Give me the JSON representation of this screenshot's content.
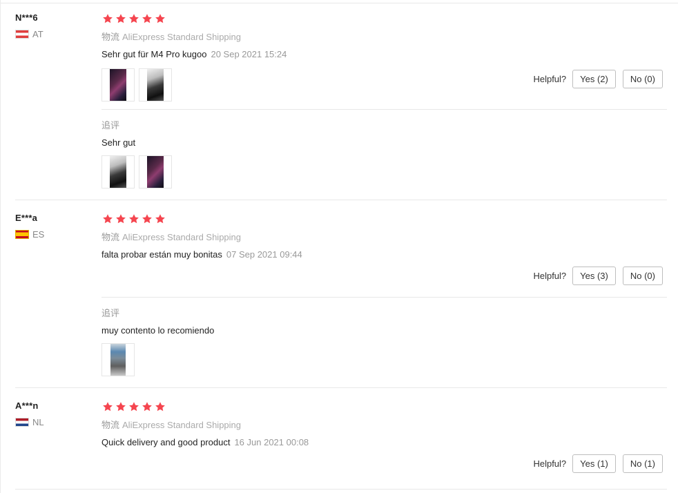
{
  "helpful_label": "Helpful?",
  "additional_label": "追评",
  "shipping_label": "物流",
  "reviews": [
    {
      "user": "N***6",
      "country": "AT",
      "rating": 5,
      "shipping_method": "AliExpress Standard Shipping",
      "text": "Sehr gut für M4 Pro kugoo",
      "date": "20 Sep 2021 15:24",
      "yes_label": "Yes (2)",
      "no_label": "No (0)",
      "additional_text": "Sehr gut"
    },
    {
      "user": "E***a",
      "country": "ES",
      "rating": 5,
      "shipping_method": "AliExpress Standard Shipping",
      "text": "falta probar están muy bonitas",
      "date": "07 Sep 2021 09:44",
      "yes_label": "Yes (3)",
      "no_label": "No (0)",
      "additional_text": "muy contento lo recomiendo"
    },
    {
      "user": "A***n",
      "country": "NL",
      "rating": 5,
      "shipping_method": "AliExpress Standard Shipping",
      "text": "Quick delivery and good product",
      "date": "16 Jun 2021 00:08",
      "yes_label": "Yes (1)",
      "no_label": "No (1)"
    }
  ],
  "colors": {
    "star": "#f5454f",
    "secondary_text": "#999999",
    "border": "#e8e8e8"
  },
  "icons": {
    "star": "star-icon",
    "flag_at": "austria-flag-icon",
    "flag_es": "spain-flag-icon",
    "flag_nl": "netherlands-flag-icon"
  }
}
